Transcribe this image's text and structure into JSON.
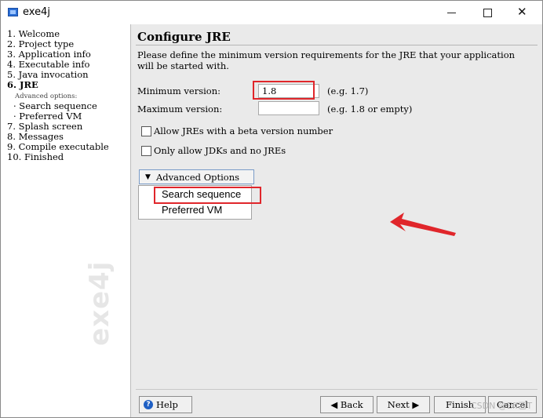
{
  "window": {
    "title": "exe4j"
  },
  "steps": [
    {
      "label": "1. Welcome"
    },
    {
      "label": "2. Project type"
    },
    {
      "label": "3. Application info"
    },
    {
      "label": "4. Executable info"
    },
    {
      "label": "5. Java invocation"
    },
    {
      "label": "6. JRE"
    },
    {
      "label": "Advanced options:"
    },
    {
      "label": "· Search sequence"
    },
    {
      "label": "· Preferred VM"
    },
    {
      "label": "7. Splash screen"
    },
    {
      "label": "8. Messages"
    },
    {
      "label": "9. Compile executable"
    },
    {
      "label": "10. Finished"
    }
  ],
  "sidebar_watermark": "exe4j",
  "page": {
    "heading": "Configure JRE",
    "description": "Please define the minimum version requirements for the JRE that your application will be started with.",
    "min_version": {
      "label": "Minimum version:",
      "value": "1.8",
      "hint": "(e.g. 1.7)"
    },
    "max_version": {
      "label": "Maximum version:",
      "value": "",
      "hint": "(e.g. 1.8 or empty)"
    },
    "beta_checkbox": {
      "label": "Allow JREs with a beta version number",
      "checked": false
    },
    "jdk_checkbox": {
      "label": "Only allow JDKs and no JREs",
      "checked": false
    },
    "advanced_button": "Advanced Options",
    "advanced_menu": [
      "Search sequence",
      "Preferred VM"
    ]
  },
  "footer": {
    "help": "Help",
    "back": "◀ Back",
    "next": "Next ▶",
    "finish": "Finish",
    "cancel": "Cancel"
  },
  "watermark": "CSDN @Eff乙T",
  "colors": {
    "highlight": "#e0262b",
    "accent": "#1e5fc4"
  },
  "icons": [
    "app-icon",
    "minimize-icon",
    "maximize-icon",
    "close-icon",
    "triangle-down-icon",
    "help-icon",
    "annotation-arrow"
  ]
}
